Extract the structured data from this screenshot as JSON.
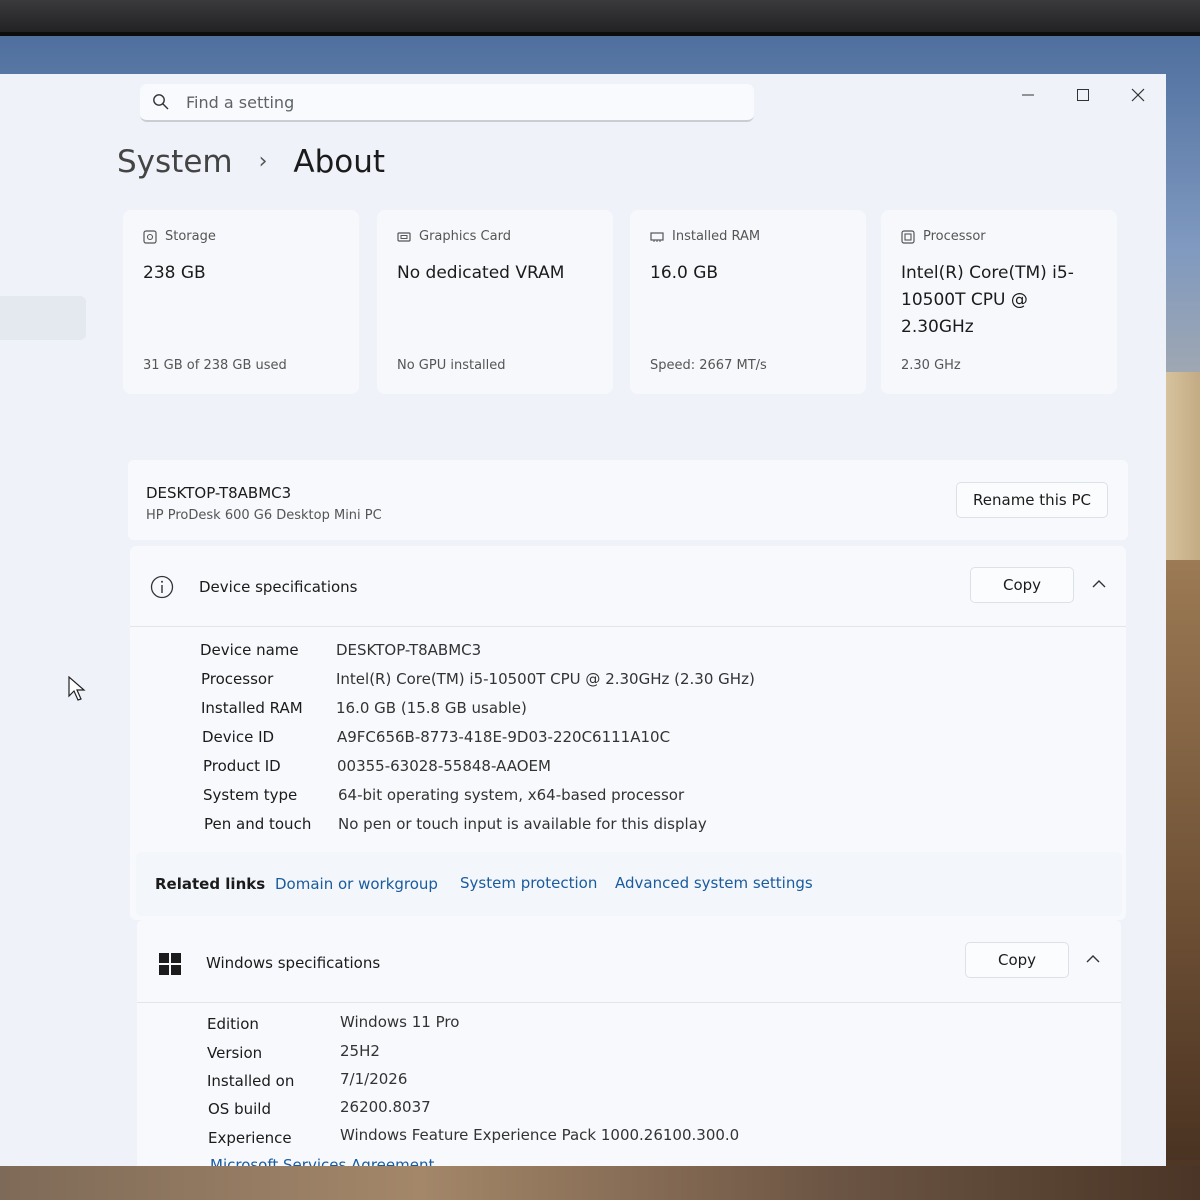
{
  "search": {
    "placeholder": "Find a setting"
  },
  "breadcrumb": {
    "parent": "System",
    "separator": "›",
    "current": "About"
  },
  "window_controls": {
    "minimize": "minimize-icon",
    "maximize": "maximize-icon",
    "close": "close-icon"
  },
  "cards": [
    {
      "icon": "storage-icon",
      "label": "Storage",
      "value": "238 GB",
      "sub": "31 GB of 238 GB used"
    },
    {
      "icon": "graphics-card-icon",
      "label": "Graphics Card",
      "value": "No dedicated VRAM",
      "sub": "No GPU installed"
    },
    {
      "icon": "ram-icon",
      "label": "Installed RAM",
      "value": "16.0 GB",
      "sub": "Speed: 2667 MT/s"
    },
    {
      "icon": "processor-icon",
      "label": "Processor",
      "value": "Intel(R) Core(TM) i5-10500T CPU @ 2.30GHz",
      "sub": "2.30 GHz"
    }
  ],
  "pc": {
    "name": "DESKTOP-T8ABMC3",
    "model": "HP ProDesk 600 G6 Desktop Mini PC",
    "rename_label": "Rename this PC"
  },
  "device_specs": {
    "title": "Device specifications",
    "copy_label": "Copy",
    "rows": [
      {
        "label": "Device name",
        "value": "DESKTOP-T8ABMC3"
      },
      {
        "label": "Processor",
        "value": "Intel(R) Core(TM) i5-10500T CPU @ 2.30GHz (2.30 GHz)"
      },
      {
        "label": "Installed RAM",
        "value": "16.0 GB (15.8 GB usable)"
      },
      {
        "label": "Device ID",
        "value": "A9FC656B-8773-418E-9D03-220C6111A10C"
      },
      {
        "label": "Product ID",
        "value": "00355-63028-55848-AAOEM"
      },
      {
        "label": "System type",
        "value": "64-bit operating system, x64-based processor"
      },
      {
        "label": "Pen and touch",
        "value": "No pen or touch input is available for this display"
      }
    ]
  },
  "related_links": {
    "label": "Related links",
    "links": [
      "Domain or workgroup",
      "System protection",
      "Advanced system settings"
    ]
  },
  "windows_specs": {
    "title": "Windows specifications",
    "copy_label": "Copy",
    "rows": [
      {
        "label": "Edition",
        "value": "Windows 11 Pro"
      },
      {
        "label": "Version",
        "value": "25H2"
      },
      {
        "label": "Installed on",
        "value": "7/1/2026"
      },
      {
        "label": "OS build",
        "value": "26200.8037"
      },
      {
        "label": "Experience",
        "value": "Windows Feature Experience Pack 1000.26100.300.0"
      }
    ],
    "footer_link": "Microsoft Services Agreement"
  },
  "colors": {
    "accent_link": "#1a5b9e",
    "window_bg": "#eff3f9",
    "card_bg": "#f6f8fb"
  }
}
